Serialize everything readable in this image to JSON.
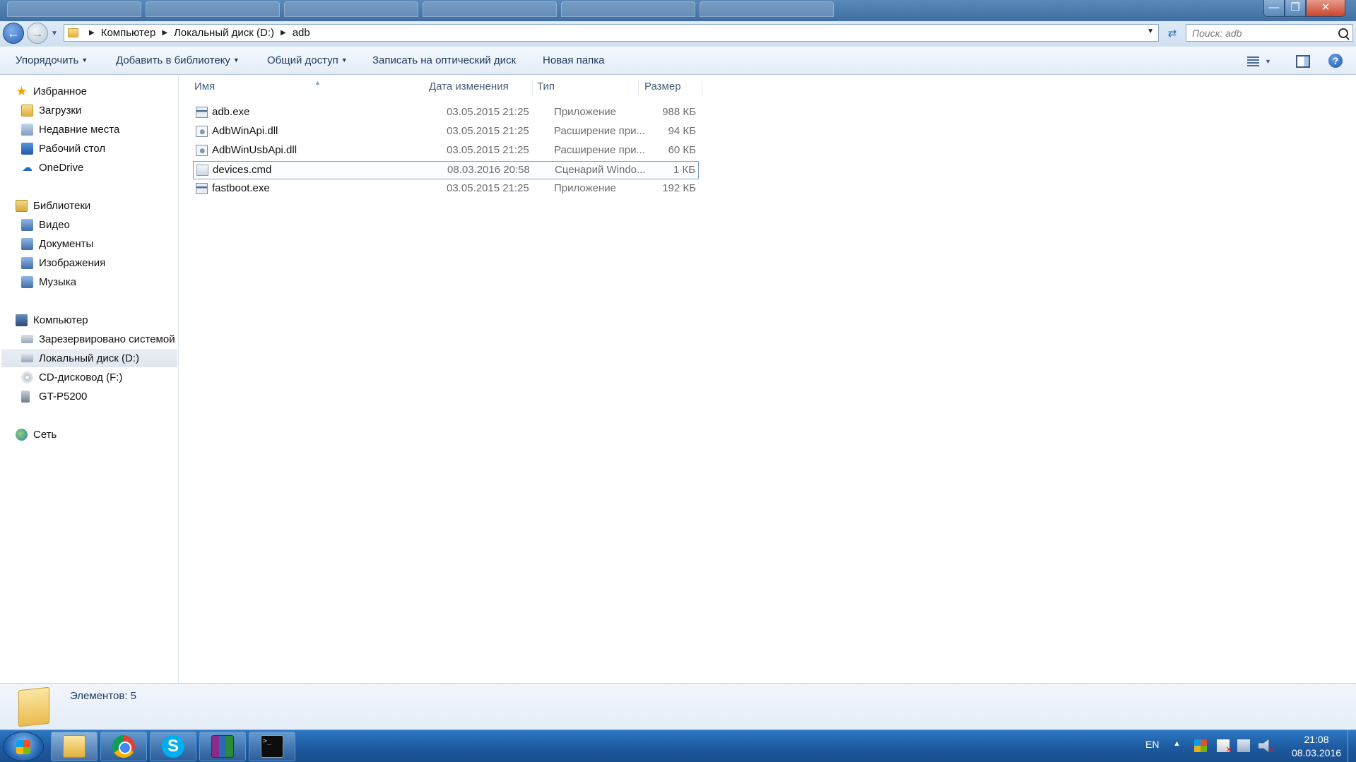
{
  "window": {
    "controls": {
      "minimize": "—",
      "maximize": "❐",
      "close": "✕"
    }
  },
  "address": {
    "crumbs": [
      "Компьютер",
      "Локальный диск (D:)",
      "adb"
    ],
    "search_placeholder": "Поиск: adb"
  },
  "toolbar": {
    "organize": "Упорядочить",
    "add_to_library": "Добавить в библиотеку",
    "share": "Общий доступ",
    "burn": "Записать на оптический диск",
    "new_folder": "Новая папка",
    "help": "?"
  },
  "nav": {
    "favorites": "Избранное",
    "downloads": "Загрузки",
    "recent": "Недавние места",
    "desktop": "Рабочий стол",
    "onedrive": "OneDrive",
    "libraries": "Библиотеки",
    "video": "Видео",
    "documents": "Документы",
    "pictures": "Изображения",
    "music": "Музыка",
    "computer": "Компьютер",
    "reserved": "Зарезервировано системой",
    "local_d": "Локальный диск (D:)",
    "cd": "CD-дисковод (F:)",
    "device": "GT-P5200",
    "network": "Сеть"
  },
  "columns": {
    "name": "Имя",
    "date": "Дата изменения",
    "type": "Тип",
    "size": "Размер"
  },
  "files": [
    {
      "name": "adb.exe",
      "date": "03.05.2015 21:25",
      "type": "Приложение",
      "size": "988 КБ",
      "icon": "exe-icon"
    },
    {
      "name": "AdbWinApi.dll",
      "date": "03.05.2015 21:25",
      "type": "Расширение при...",
      "size": "94 КБ",
      "icon": "dll-icon"
    },
    {
      "name": "AdbWinUsbApi.dll",
      "date": "03.05.2015 21:25",
      "type": "Расширение при...",
      "size": "60 КБ",
      "icon": "dll-icon"
    },
    {
      "name": "devices.cmd",
      "date": "08.03.2016 20:58",
      "type": "Сценарий Windo...",
      "size": "1 КБ",
      "icon": "cmd-icon"
    },
    {
      "name": "fastboot.exe",
      "date": "03.05.2015 21:25",
      "type": "Приложение",
      "size": "192 КБ",
      "icon": "exe-icon"
    }
  ],
  "details": {
    "item_count": "Элементов: 5"
  },
  "taskbar": {
    "apps": [
      "explorer",
      "chrome",
      "skype",
      "winrar",
      "cmd"
    ],
    "skype_letter": "S",
    "cmd_prompt": ">_",
    "lang": "EN",
    "time": "21:08",
    "date": "08.03.2016"
  }
}
